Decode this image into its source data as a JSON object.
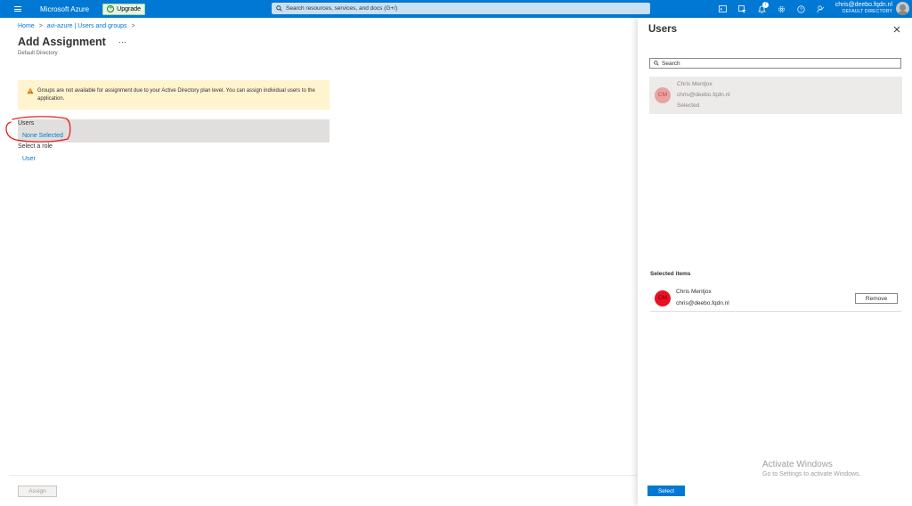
{
  "topbar": {
    "brand": "Microsoft Azure",
    "upgrade_label": "Upgrade",
    "search_placeholder": "Search resources, services, and docs (G+/)",
    "notification_count": "7",
    "account_email": "chris@deebo.fqdn.nl",
    "account_directory": "DEFAULT DIRECTORY",
    "accent_color": "#0078d4"
  },
  "breadcrumb": {
    "items": [
      "Home",
      "avi-azure | Users and groups"
    ],
    "separator": ">"
  },
  "page": {
    "title": "Add Assignment",
    "more": "···",
    "subtitle": "Default Directory",
    "warning": "Groups are not available for assignment due to your Active Directory plan level. You can assign individual users to the application.",
    "users_label": "Users",
    "users_value": "None Selected",
    "role_label": "Select a role",
    "role_value": "User",
    "assign_label": "Assign"
  },
  "panel": {
    "title": "Users",
    "search_placeholder": "Search",
    "results": [
      {
        "initials": "CM",
        "name": "Chris Mentjox",
        "email": "chris@deebo.fqdn.nl",
        "status": "Selected"
      }
    ],
    "selected_heading": "Selected items",
    "selected": [
      {
        "initials": "CM",
        "name": "Chris Mentjox",
        "email": "chris@deebo.fqdn.nl",
        "remove_label": "Remove"
      }
    ],
    "select_label": "Select"
  },
  "watermark": {
    "line1": "Activate Windows",
    "line2": "Go to Settings to activate Windows."
  }
}
